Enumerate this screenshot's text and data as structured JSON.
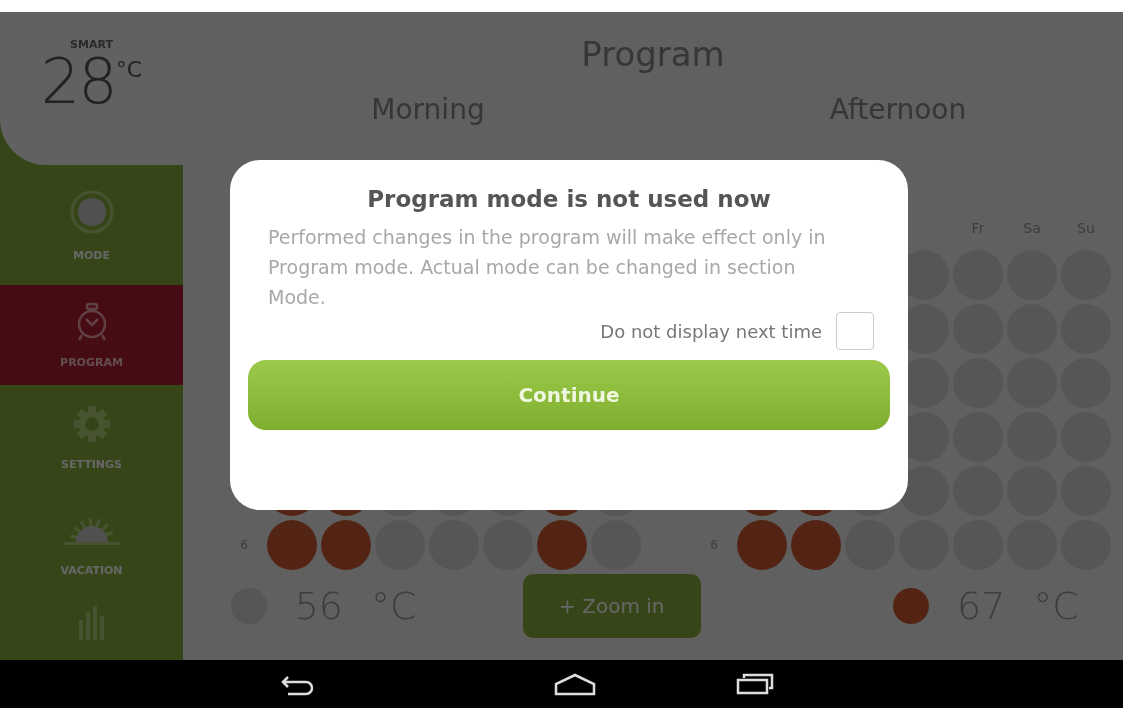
{
  "sidebar": {
    "mode_label": "SMART",
    "temperature": "28",
    "unit": "°C",
    "items": [
      {
        "kind": "mode",
        "label": "MODE",
        "selected": false
      },
      {
        "kind": "alarm",
        "label": "PROGRAM",
        "selected": true
      },
      {
        "kind": "gear",
        "label": "SETTINGS",
        "selected": false
      },
      {
        "kind": "sun",
        "label": "VACATION",
        "selected": false
      },
      {
        "kind": "bars",
        "selected": false
      }
    ]
  },
  "title": "Program",
  "schedules": [
    {
      "title": "Morning",
      "rows": [
        {
          "cells": [
            true,
            true,
            false,
            false,
            false,
            true,
            false
          ]
        },
        {
          "label": "6",
          "cells": [
            true,
            true,
            false,
            false,
            false,
            true,
            false
          ]
        }
      ],
      "footer": {
        "on": false,
        "temperature": "56",
        "unit": "°C"
      }
    },
    {
      "title": "Afternoon",
      "days": [
        "Fr",
        "Sa",
        "Su"
      ],
      "rows": [
        {
          "cells": [
            null,
            null,
            null,
            false,
            false,
            false,
            false
          ]
        },
        {
          "cells": [
            null,
            null,
            null,
            false,
            false,
            false,
            false
          ]
        },
        {
          "cells": [
            null,
            null,
            null,
            false,
            false,
            false,
            false
          ]
        },
        {
          "cells": [
            null,
            null,
            null,
            false,
            false,
            false,
            false
          ]
        },
        {
          "cells": [
            true,
            true,
            false,
            false,
            false,
            false,
            false
          ]
        },
        {
          "label": "6",
          "cells": [
            true,
            true,
            false,
            false,
            false,
            false,
            false
          ]
        }
      ],
      "footer": {
        "on": true,
        "temperature": "67",
        "unit": "°C"
      }
    }
  ],
  "zoom_button": "+ Zoom in",
  "dialog": {
    "title": "Program mode is not used now",
    "message": "Performed changes in the program will make effect only in Program mode. Actual mode can be changed in section Mode.",
    "checkbox": {
      "label": "Do not display next time",
      "checked": false
    },
    "button": "Continue"
  }
}
